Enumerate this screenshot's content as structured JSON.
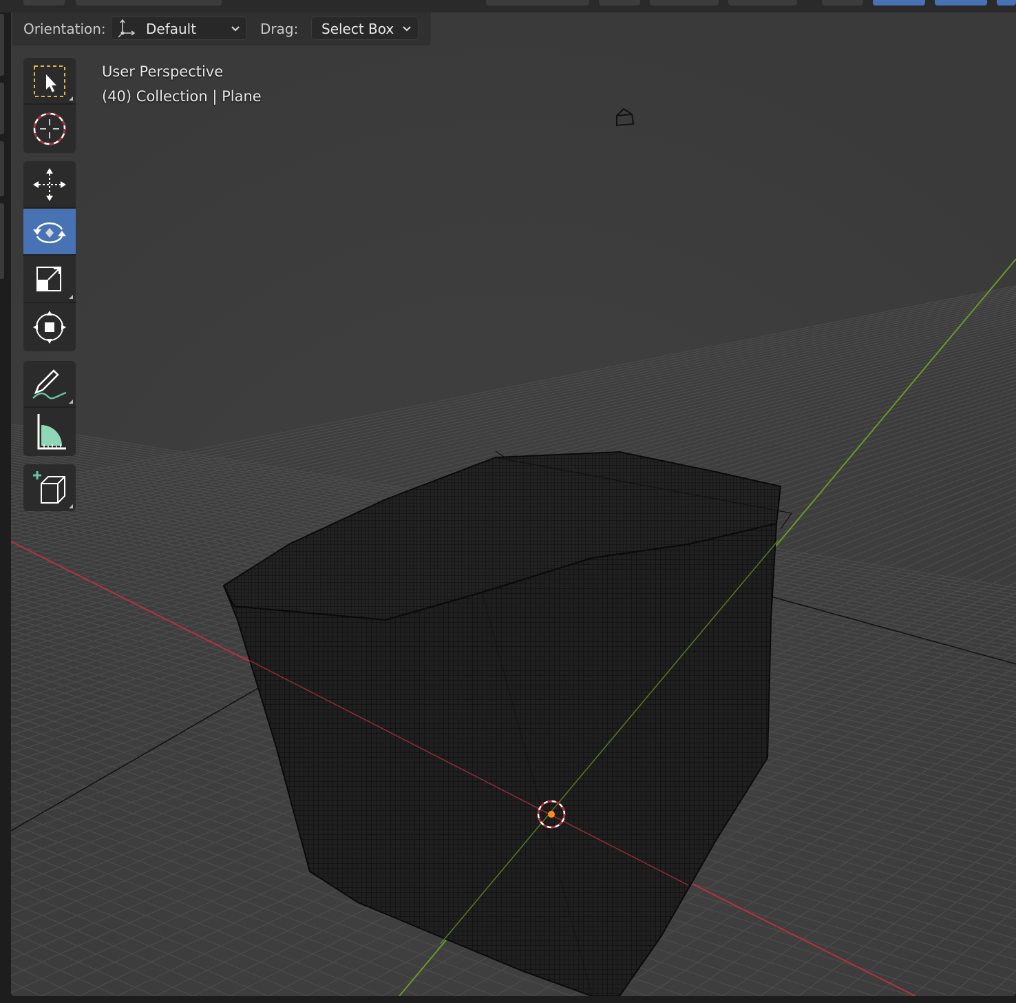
{
  "tool_settings": {
    "orientation_label": "Orientation:",
    "orientation_value": "Default",
    "drag_label": "Drag:",
    "drag_value": "Select Box"
  },
  "viewport": {
    "view_name": "User Perspective",
    "object_info": "(40) Collection | Plane"
  },
  "toolbar": {
    "tools": [
      {
        "name": "select-box",
        "icon": "select-box-icon"
      },
      {
        "name": "cursor",
        "icon": "cursor-icon"
      },
      {
        "name": "move",
        "icon": "move-icon"
      },
      {
        "name": "rotate",
        "icon": "rotate-icon",
        "active": true
      },
      {
        "name": "scale",
        "icon": "scale-icon"
      },
      {
        "name": "transform",
        "icon": "transform-icon"
      },
      {
        "name": "annotate",
        "icon": "annotate-icon"
      },
      {
        "name": "measure",
        "icon": "measure-icon"
      },
      {
        "name": "add-cube",
        "icon": "add-cube-icon"
      }
    ]
  },
  "colors": {
    "viewport_bg": "#3d3d3d",
    "grid_line": "#4a4a4a",
    "x_axis": "#b8303f",
    "y_axis": "#6a9a22",
    "active_tool": "#4772b3",
    "origin": "#ff8c1a"
  }
}
